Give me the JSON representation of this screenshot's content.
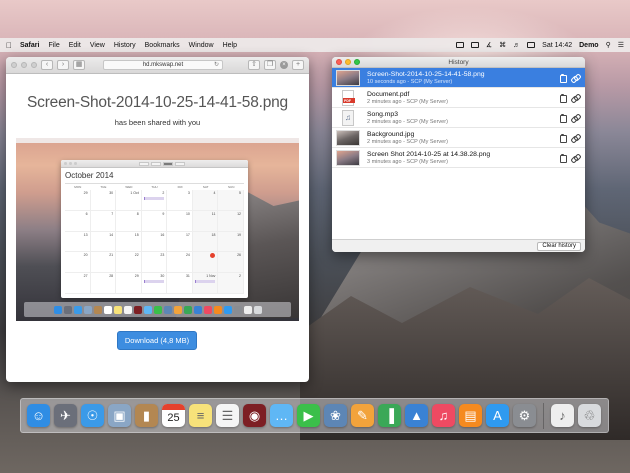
{
  "menubar": {
    "app_name": "Safari",
    "items": [
      "File",
      "Edit",
      "View",
      "History",
      "Bookmarks",
      "Window",
      "Help"
    ],
    "clock": "Sat 14:42",
    "user": "Demo"
  },
  "safari": {
    "address": "hd.mkswap.net",
    "page_title": "Screen-Shot-2014-10-25-14-41-58.png",
    "page_subtitle": "has been shared with you",
    "download_label": "Download (4,8 MB)",
    "preview": {
      "month": "October",
      "year": "2014",
      "weekdays": [
        "MON",
        "TUE",
        "WED",
        "THU",
        "FRI",
        "SAT",
        "SUN"
      ],
      "weeks": [
        [
          "29",
          "30",
          "1 Oct",
          "2",
          "3",
          "4",
          "5"
        ],
        [
          "6",
          "7",
          "8",
          "9",
          "10",
          "11",
          "12"
        ],
        [
          "13",
          "14",
          "15",
          "16",
          "17",
          "18",
          "19"
        ],
        [
          "20",
          "21",
          "22",
          "23",
          "24",
          "25",
          "26"
        ],
        [
          "27",
          "28",
          "29",
          "30",
          "31",
          "1 Nov",
          "2"
        ]
      ]
    }
  },
  "history": {
    "title": "History",
    "items": [
      {
        "name": "Screen-Shot-2014-10-25-14-41-58.png",
        "meta": "10 seconds ago - SCP (My Server)",
        "kind": "screenshot",
        "selected": true
      },
      {
        "name": "Document.pdf",
        "meta": "2 minutes ago - SCP (My Server)",
        "kind": "pdf",
        "selected": false
      },
      {
        "name": "Song.mp3",
        "meta": "2 minutes ago - SCP (My Server)",
        "kind": "audio",
        "selected": false
      },
      {
        "name": "Background.jpg",
        "meta": "2 minutes ago - SCP (My Server)",
        "kind": "image",
        "selected": false
      },
      {
        "name": "Screen Shot 2014-10-25 at 14.38.28.png",
        "meta": "3 minutes ago - SCP (My Server)",
        "kind": "screenshot",
        "selected": false
      }
    ],
    "pdf_label": "PDF",
    "clear_label": "Clear history"
  },
  "dock": {
    "calendar_day": "25",
    "icons": [
      {
        "name": "finder-icon",
        "color": "#2f8de4"
      },
      {
        "name": "launchpad-icon",
        "color": "#6b6f7a"
      },
      {
        "name": "safari-icon",
        "color": "#3b9ae8"
      },
      {
        "name": "preview-icon",
        "color": "#8aa6c5"
      },
      {
        "name": "contacts-icon",
        "color": "#b38752"
      },
      {
        "name": "calendar-icon",
        "color": "#ffffff"
      },
      {
        "name": "notes-icon",
        "color": "#f7e27a"
      },
      {
        "name": "reminders-icon",
        "color": "#f5f5f5"
      },
      {
        "name": "photo-booth-icon",
        "color": "#7d1f24"
      },
      {
        "name": "messages-icon",
        "color": "#5fb7f5"
      },
      {
        "name": "facetime-icon",
        "color": "#3bbf4a"
      },
      {
        "name": "iphoto-icon",
        "color": "#5d86b5"
      },
      {
        "name": "pages-icon",
        "color": "#f2a33b"
      },
      {
        "name": "numbers-icon",
        "color": "#3aa857"
      },
      {
        "name": "keynote-icon",
        "color": "#3a82d4"
      },
      {
        "name": "itunes-icon",
        "color": "#ee4a62"
      },
      {
        "name": "ibooks-icon",
        "color": "#f58a1f"
      },
      {
        "name": "app-store-icon",
        "color": "#2f9af0"
      },
      {
        "name": "system-preferences-icon",
        "color": "#8a8d92"
      },
      {
        "name": "document-stack-icon",
        "color": "#eeeeee"
      },
      {
        "name": "trash-icon",
        "color": "#d8dadd"
      }
    ]
  }
}
